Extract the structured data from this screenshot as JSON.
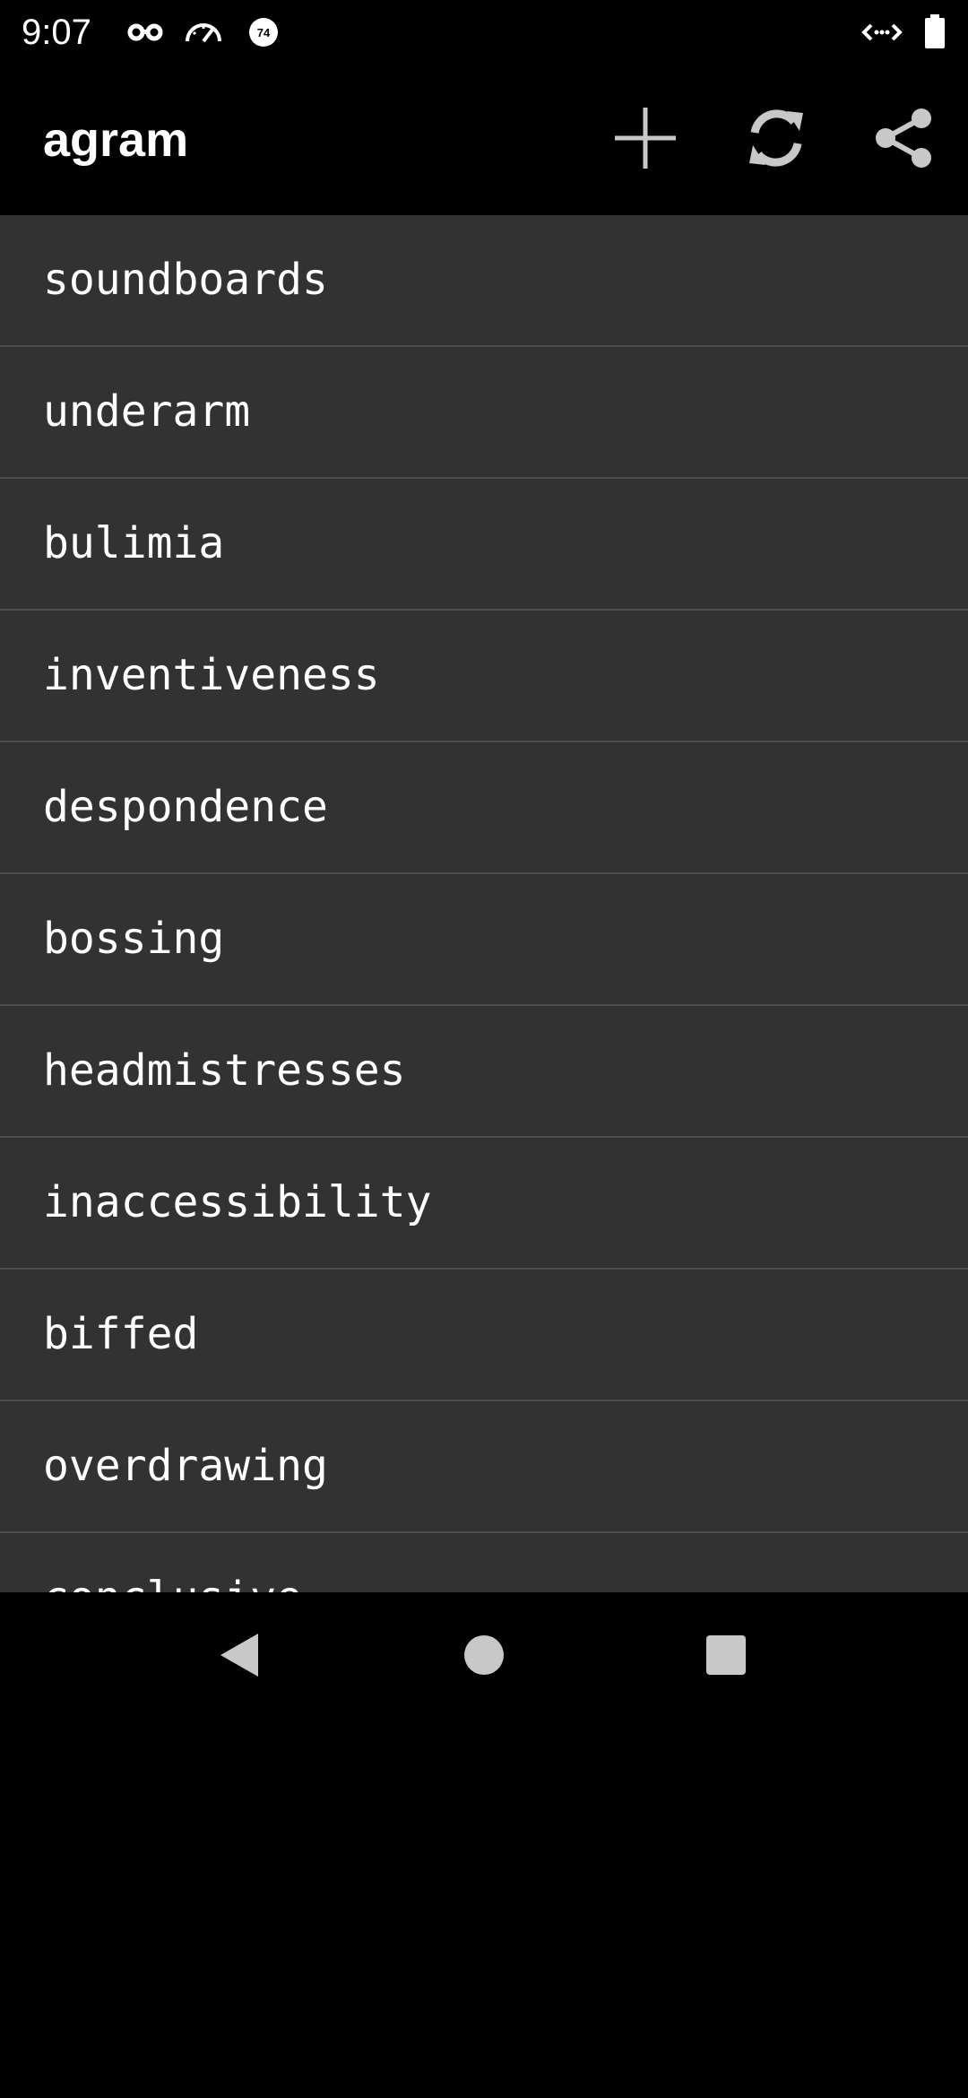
{
  "status_bar": {
    "time": "9:07",
    "icons": [
      "incognito-icon",
      "speedometer-icon",
      "notification-badge-icon",
      "data-transfer-icon",
      "battery-icon"
    ],
    "badge_number": "74"
  },
  "app_bar": {
    "title": "agram",
    "actions": [
      "add-icon",
      "refresh-icon",
      "share-icon"
    ]
  },
  "list": {
    "items": [
      "soundboards",
      "underarm",
      "bulimia",
      "inventiveness",
      "despondence",
      "bossing",
      "headmistresses",
      "inaccessibility",
      "biffed",
      "overdrawing",
      "conclusive"
    ]
  },
  "nav_bar": {
    "buttons": [
      "back-icon",
      "home-icon",
      "recents-icon"
    ]
  },
  "colors": {
    "background": "#000000",
    "list_background": "#323232",
    "divider": "#4e4e4e",
    "icon_gray": "#c8c8c8",
    "text": "#ffffff"
  }
}
